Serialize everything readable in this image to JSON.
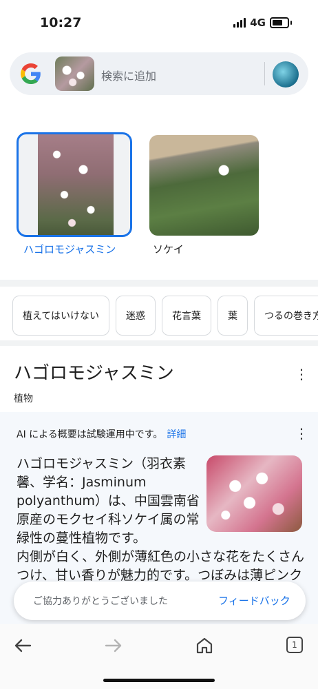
{
  "status_bar": {
    "time": "10:27",
    "network": "4G"
  },
  "search": {
    "placeholder": "検索に追加"
  },
  "results": [
    {
      "label": "ハゴロモジャスミン"
    },
    {
      "label": "ソケイ"
    }
  ],
  "chips": [
    "植えてはいけない",
    "迷惑",
    "花言葉",
    "葉",
    "つるの巻き方"
  ],
  "knowledge": {
    "title": "ハゴロモジャスミン",
    "subtitle": "植物"
  },
  "ai": {
    "notice": "AI による概要は試験運用中です。",
    "link": "詳細",
    "text_part1": "ハゴロモジャスミン（羽衣素馨、学名：Jasminum polyanthum）は、中国雲南省原産のモクセイ科ソケイ属の常緑性の蔓性植物です。",
    "text_part2": "内側が白く、外側が薄紅色の小さな花をたくさんつけ、甘い香りが魅力的です。つぼみは薄ピンク色で白い花とのコント"
  },
  "toast": {
    "text": "ご協力ありがとうございました",
    "button": "フィードバック"
  },
  "nav": {
    "tab_count": "1"
  },
  "colors": {
    "accent": "#1a73e8",
    "ai_bg": "#f5f8fc"
  }
}
